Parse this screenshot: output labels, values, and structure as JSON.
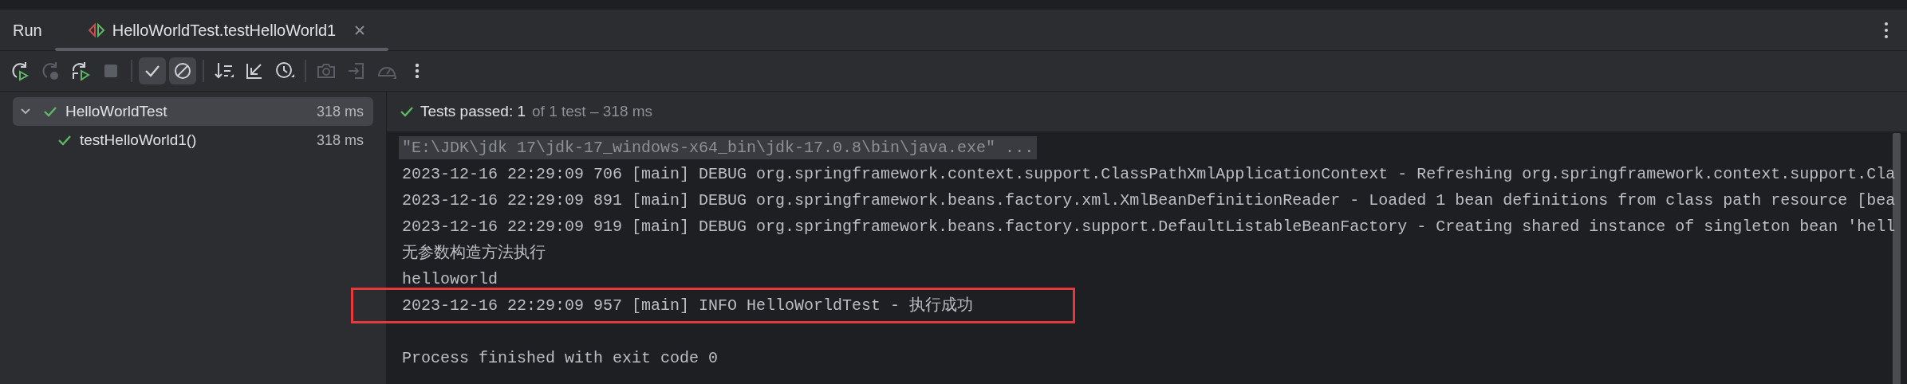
{
  "tool_window": {
    "title": "Run"
  },
  "tabs": [
    {
      "label": "HelloWorldTest.testHelloWorld1",
      "selected": true,
      "closable": true
    }
  ],
  "toolbar_groups": [
    {
      "buttons": [
        {
          "kind": "rerun",
          "disabled": false,
          "selected": false
        },
        {
          "kind": "rerun-failed",
          "disabled": true,
          "selected": false
        },
        {
          "kind": "toggle-auto-test",
          "disabled": false,
          "selected": false
        },
        {
          "kind": "stop",
          "disabled": true,
          "selected": false
        }
      ]
    },
    {
      "buttons": [
        {
          "kind": "show-passed",
          "disabled": false,
          "selected": true
        },
        {
          "kind": "show-ignored",
          "disabled": false,
          "selected": true
        }
      ]
    },
    {
      "buttons": [
        {
          "kind": "sort",
          "disabled": false,
          "selected": false
        },
        {
          "kind": "import",
          "disabled": false,
          "selected": false
        },
        {
          "kind": "history",
          "disabled": false,
          "selected": false
        }
      ]
    },
    {
      "buttons": [
        {
          "kind": "screenshot",
          "disabled": true,
          "selected": false
        },
        {
          "kind": "export",
          "disabled": true,
          "selected": false
        },
        {
          "kind": "speed",
          "disabled": true,
          "selected": false
        },
        {
          "kind": "more",
          "disabled": false,
          "selected": false
        }
      ]
    }
  ],
  "test_tree": [
    {
      "name": "HelloWorldTest",
      "duration": "318 ms",
      "passed": true,
      "expanded": true,
      "selected": true,
      "children": [
        {
          "name": "testHelloWorld1()",
          "duration": "318 ms",
          "passed": true,
          "selected": false
        }
      ]
    }
  ],
  "summary": {
    "passed": true,
    "label": "Tests passed: 1",
    "detail": "of 1 test – 318 ms"
  },
  "console": {
    "lines": [
      {
        "kind": "command",
        "text": "\"E:\\JDK\\jdk 17\\jdk-17_windows-x64_bin\\jdk-17.0.8\\bin\\java.exe\" ...",
        "highlighted": false
      },
      {
        "kind": "output",
        "text": "2023-12-16 22:29:09 706 [main] DEBUG org.springframework.context.support.ClassPathXmlApplicationContext - Refreshing org.springframework.context.support.Cla",
        "highlighted": false
      },
      {
        "kind": "output",
        "text": "2023-12-16 22:29:09 891 [main] DEBUG org.springframework.beans.factory.xml.XmlBeanDefinitionReader - Loaded 1 bean definitions from class path resource [bea",
        "highlighted": false
      },
      {
        "kind": "output",
        "text": "2023-12-16 22:29:09 919 [main] DEBUG org.springframework.beans.factory.support.DefaultListableBeanFactory - Creating shared instance of singleton bean 'hell",
        "highlighted": false
      },
      {
        "kind": "output",
        "text": "无参数构造方法执行",
        "highlighted": false
      },
      {
        "kind": "output",
        "text": "helloworld",
        "highlighted": false
      },
      {
        "kind": "output",
        "text": "2023-12-16 22:29:09 957 [main] INFO HelloWorldTest - 执行成功",
        "highlighted": true
      },
      {
        "kind": "blank"
      },
      {
        "kind": "output",
        "text": "Process finished with exit code 0",
        "highlighted": false
      }
    ]
  }
}
